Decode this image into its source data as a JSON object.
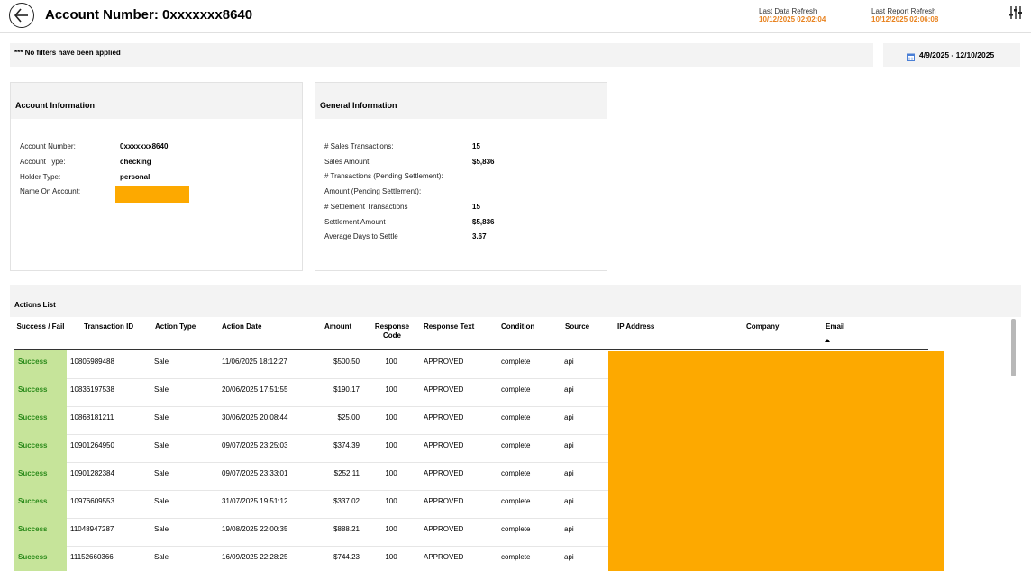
{
  "header": {
    "title": "Account Number: 0xxxxxxx8640",
    "last_data_refresh_label": "Last Data Refresh",
    "last_data_refresh_value": "10/12/2025 02:02:04",
    "last_report_refresh_label": "Last Report Refresh",
    "last_report_refresh_value": "10/12/2025 02:06:08"
  },
  "filters": {
    "text": "*** No filters have been applied",
    "date_range": "4/9/2025 - 12/10/2025"
  },
  "account_info": {
    "title": "Account Information",
    "items": [
      {
        "label": "Account Number:",
        "value": "0xxxxxxx8640"
      },
      {
        "label": "Account Type:",
        "value": "checking"
      },
      {
        "label": "Holder Type:",
        "value": "personal"
      },
      {
        "label": "Name On Account:",
        "value": ""
      }
    ]
  },
  "general_info": {
    "title": "General Information",
    "items": [
      {
        "label": "# Sales Transactions:",
        "value": "15"
      },
      {
        "label": "Sales Amount",
        "value": "$5,836"
      },
      {
        "label": "# Transactions (Pending Settlement):",
        "value": ""
      },
      {
        "label": "Amount (Pending Settlement):",
        "value": ""
      },
      {
        "label": "# Settlement Transactions",
        "value": "15"
      },
      {
        "label": "Settlement Amount",
        "value": "$5,836"
      },
      {
        "label": "Average Days to Settle",
        "value": "3.67"
      }
    ]
  },
  "actions": {
    "title": "Actions List",
    "columns": [
      "Success / Fail",
      "Transaction ID",
      "Action Type",
      "Action Date",
      "Amount",
      "Response Code",
      "Response Text",
      "Condition",
      "Source",
      "IP Address",
      "Company",
      "Email"
    ],
    "rows": [
      {
        "status": "Success",
        "id": "10805989488",
        "type": "Sale",
        "date": "11/06/2025 18:12:27",
        "amount": "$500.50",
        "code": "100",
        "text": "APPROVED",
        "condition": "complete",
        "source": "api"
      },
      {
        "status": "Success",
        "id": "10836197538",
        "type": "Sale",
        "date": "20/06/2025 17:51:55",
        "amount": "$190.17",
        "code": "100",
        "text": "APPROVED",
        "condition": "complete",
        "source": "api"
      },
      {
        "status": "Success",
        "id": "10868181211",
        "type": "Sale",
        "date": "30/06/2025 20:08:44",
        "amount": "$25.00",
        "code": "100",
        "text": "APPROVED",
        "condition": "complete",
        "source": "api"
      },
      {
        "status": "Success",
        "id": "10901264950",
        "type": "Sale",
        "date": "09/07/2025 23:25:03",
        "amount": "$374.39",
        "code": "100",
        "text": "APPROVED",
        "condition": "complete",
        "source": "api"
      },
      {
        "status": "Success",
        "id": "10901282384",
        "type": "Sale",
        "date": "09/07/2025 23:33:01",
        "amount": "$252.11",
        "code": "100",
        "text": "APPROVED",
        "condition": "complete",
        "source": "api"
      },
      {
        "status": "Success",
        "id": "10976609553",
        "type": "Sale",
        "date": "31/07/2025 19:51:12",
        "amount": "$337.02",
        "code": "100",
        "text": "APPROVED",
        "condition": "complete",
        "source": "api"
      },
      {
        "status": "Success",
        "id": "11048947287",
        "type": "Sale",
        "date": "19/08/2025 22:00:35",
        "amount": "$888.21",
        "code": "100",
        "text": "APPROVED",
        "condition": "complete",
        "source": "api"
      },
      {
        "status": "Success",
        "id": "11152660366",
        "type": "Sale",
        "date": "16/09/2025 22:28:25",
        "amount": "$744.23",
        "code": "100",
        "text": "APPROVED",
        "condition": "complete",
        "source": "api"
      }
    ]
  },
  "icons": {
    "back": "arrow-left-icon",
    "filters": "sliders-icon",
    "calendar": "calendar-icon",
    "sort": "sort-ascending-icon"
  },
  "colors": {
    "refresh_value": "#e8821e",
    "success_bg": "#c6e49a",
    "success_text": "#2a8a1a",
    "redaction": "#fda900"
  }
}
